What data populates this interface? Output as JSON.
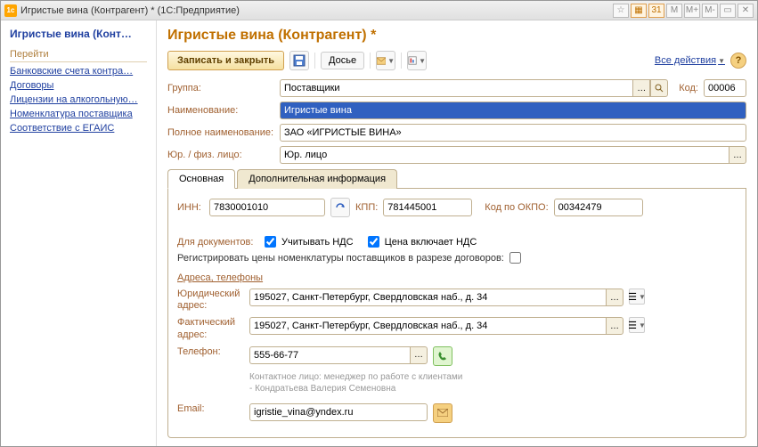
{
  "window": {
    "title": "Игристые вина (Контрагент) * (1С:Предприятие)"
  },
  "titlebar_buttons": [
    "☆",
    "▦",
    "31",
    "M",
    "M+",
    "M-",
    "▭",
    "✕"
  ],
  "sidebar": {
    "head": "Игристые вина (Конт…",
    "group": "Перейти",
    "links": [
      "Банковские счета контра…",
      "Договоры",
      "Лицензии на алкогольную…",
      "Номенклатура поставщика",
      "Соответствие с ЕГАИС"
    ]
  },
  "main": {
    "title": "Игристые вина (Контрагент) *",
    "toolbar": {
      "save_close": "Записать и закрыть",
      "dossier": "Досье",
      "all_actions": "Все действия"
    },
    "fields": {
      "group_label": "Группа:",
      "group_value": "Поставщики",
      "code_label": "Код:",
      "code_value": "00006",
      "name_label": "Наименование:",
      "name_value": "Игристые вина",
      "fullname_label": "Полное наименование:",
      "fullname_value": "ЗАО «ИГРИСТЫЕ ВИНА»",
      "jurfiz_label": "Юр. / физ. лицо:",
      "jurfiz_value": "Юр. лицо"
    },
    "tabs": {
      "t1": "Основная",
      "t2": "Дополнительная информация"
    },
    "tab1": {
      "inn_label": "ИНН:",
      "inn_value": "7830001010",
      "kpp_label": "КПП:",
      "kpp_value": "781445001",
      "okpo_label": "Код по ОКПО:",
      "okpo_value": "00342479",
      "docs_label": "Для документов:",
      "chk_nds": "Учитывать НДС",
      "chk_price_nds": "Цена включает НДС",
      "reg_prices": "Регистрировать цены номенклатуры поставщиков в разрезе договоров:",
      "section_addr": "Адреса, телефоны",
      "jur_addr_label": "Юридический адрес:",
      "jur_addr_value": "195027, Санкт-Петербург, Свердловская наб., д. 34",
      "fact_addr_label": "Фактический адрес:",
      "fact_addr_value": "195027, Санкт-Петербург, Свердловская наб., д. 34",
      "phone_label": "Телефон:",
      "phone_value": "555-66-77",
      "contact_hint": "Контактное лицо: менеджер по работе с клиентами - Кондратьева Валерия Семеновна",
      "email_label": "Email:",
      "email_value": "igristie_vina@yndex.ru"
    }
  }
}
